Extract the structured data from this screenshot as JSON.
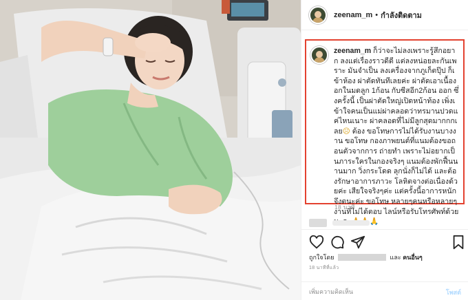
{
  "header": {
    "username": "zeenam_m",
    "separator": "•",
    "follow_status": "กำลังติดตาม"
  },
  "caption": {
    "username": "zeenam_m",
    "text_part1": " ก็ว่าจะไม่ลงเพราะรู้สึกอยาก ลงแต่เรื่องราวดีดี แต่ลงหน่อยละกันเพราะ มันจำเป็น ลงเครื่องจากภูเก็ตปุ๊ป ก็เข้าห้อง ผ่าตัดทันทีเลยค่ะ ผ่าตัดเอาเนื้องอกในมดลูก 1ก้อน กับซีสอีก2ก้อน ออก ซึ่งครั้งนี้ เป็นผ่าตัดใหญ่เปิดหน้าท้อง เพิ่งเข้าใจคนเป็นแม่ผ่าคลอดว่าทรมานปวดแค่ไหนเนาะ ผ่าคลอดที่ไม่มีลูกสุดมากกกเลย",
    "emoji_1": "☹",
    "text_part2": "  ต้อง ขอโทษการไม่ได้รับงานบางงาน ขอโทษ กองภาพยนต์ที่แนมต้องขอถอนตัวจากการ ถ่ายทำ เพราะไม่อยากเป็นภาระใครในกองจริงๆ แนมต้องพักฟื้นนานมาก วิ่งกระโดด ลุกนั่งก็ไม่ได้ และต้องรักษาอาการภาวะ โลหิตจางต่อเนื่องด้วยค่ะ เสียใจจริงๆค่ะ แต่ครั้งนี้อาการหนักจึงตนะค่ะ ขอโทษ หลายๆคนหรือหลายๆงานที่ไม่ได้ตอบ ไลน์หรือรับโทรศัพท์ด้วยนะคะ",
    "emoji_2": "🙏🙏🙏",
    "time_ago": "18 นาที"
  },
  "actions": {
    "like_icon": "heart-icon",
    "comment_icon": "comment-bubble-icon",
    "share_icon": "paper-plane-icon",
    "save_icon": "bookmark-icon"
  },
  "likes": {
    "prefix": "ถูกใจโดย",
    "and_others": "และ",
    "others_label": "คนอื่นๆ"
  },
  "post_time": "18 นาทีที่แล้ว",
  "add_comment": {
    "placeholder": "เพิ่มความคิดเห็น",
    "post_label": "โพสต์"
  },
  "colors": {
    "highlight_border": "#e3412f",
    "post_button": "#b3dbff",
    "secondary_text": "#8e8e8e"
  }
}
